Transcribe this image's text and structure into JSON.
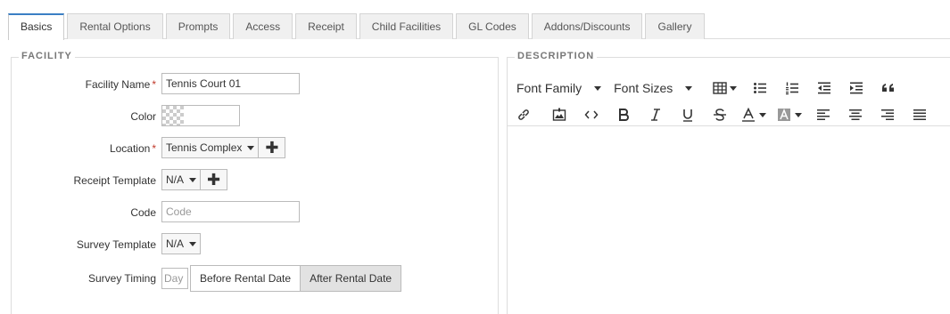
{
  "tabs": [
    {
      "label": "Basics",
      "active": true
    },
    {
      "label": "Rental Options"
    },
    {
      "label": "Prompts"
    },
    {
      "label": "Access"
    },
    {
      "label": "Receipt"
    },
    {
      "label": "Child Facilities"
    },
    {
      "label": "GL Codes"
    },
    {
      "label": "Addons/Discounts"
    },
    {
      "label": "Gallery"
    }
  ],
  "facility": {
    "legend": "FACILITY",
    "name_label": "Facility Name",
    "name_value": "Tennis Court 01",
    "color_label": "Color",
    "location_label": "Location",
    "location_value": "Tennis Complex",
    "receipt_label": "Receipt Template",
    "receipt_value": "N/A",
    "code_label": "Code",
    "code_placeholder": "Code",
    "survey_label": "Survey Template",
    "survey_value": "N/A",
    "timing_label": "Survey Timing",
    "timing_placeholder": "Day",
    "timing_options": [
      "Before Rental Date",
      "After Rental Date"
    ],
    "timing_selected": "After Rental Date",
    "required_mark": "*"
  },
  "description": {
    "legend": "DESCRIPTION",
    "font_family": "Font Family",
    "font_sizes": "Font Sizes",
    "plus_glyph": "✚"
  }
}
